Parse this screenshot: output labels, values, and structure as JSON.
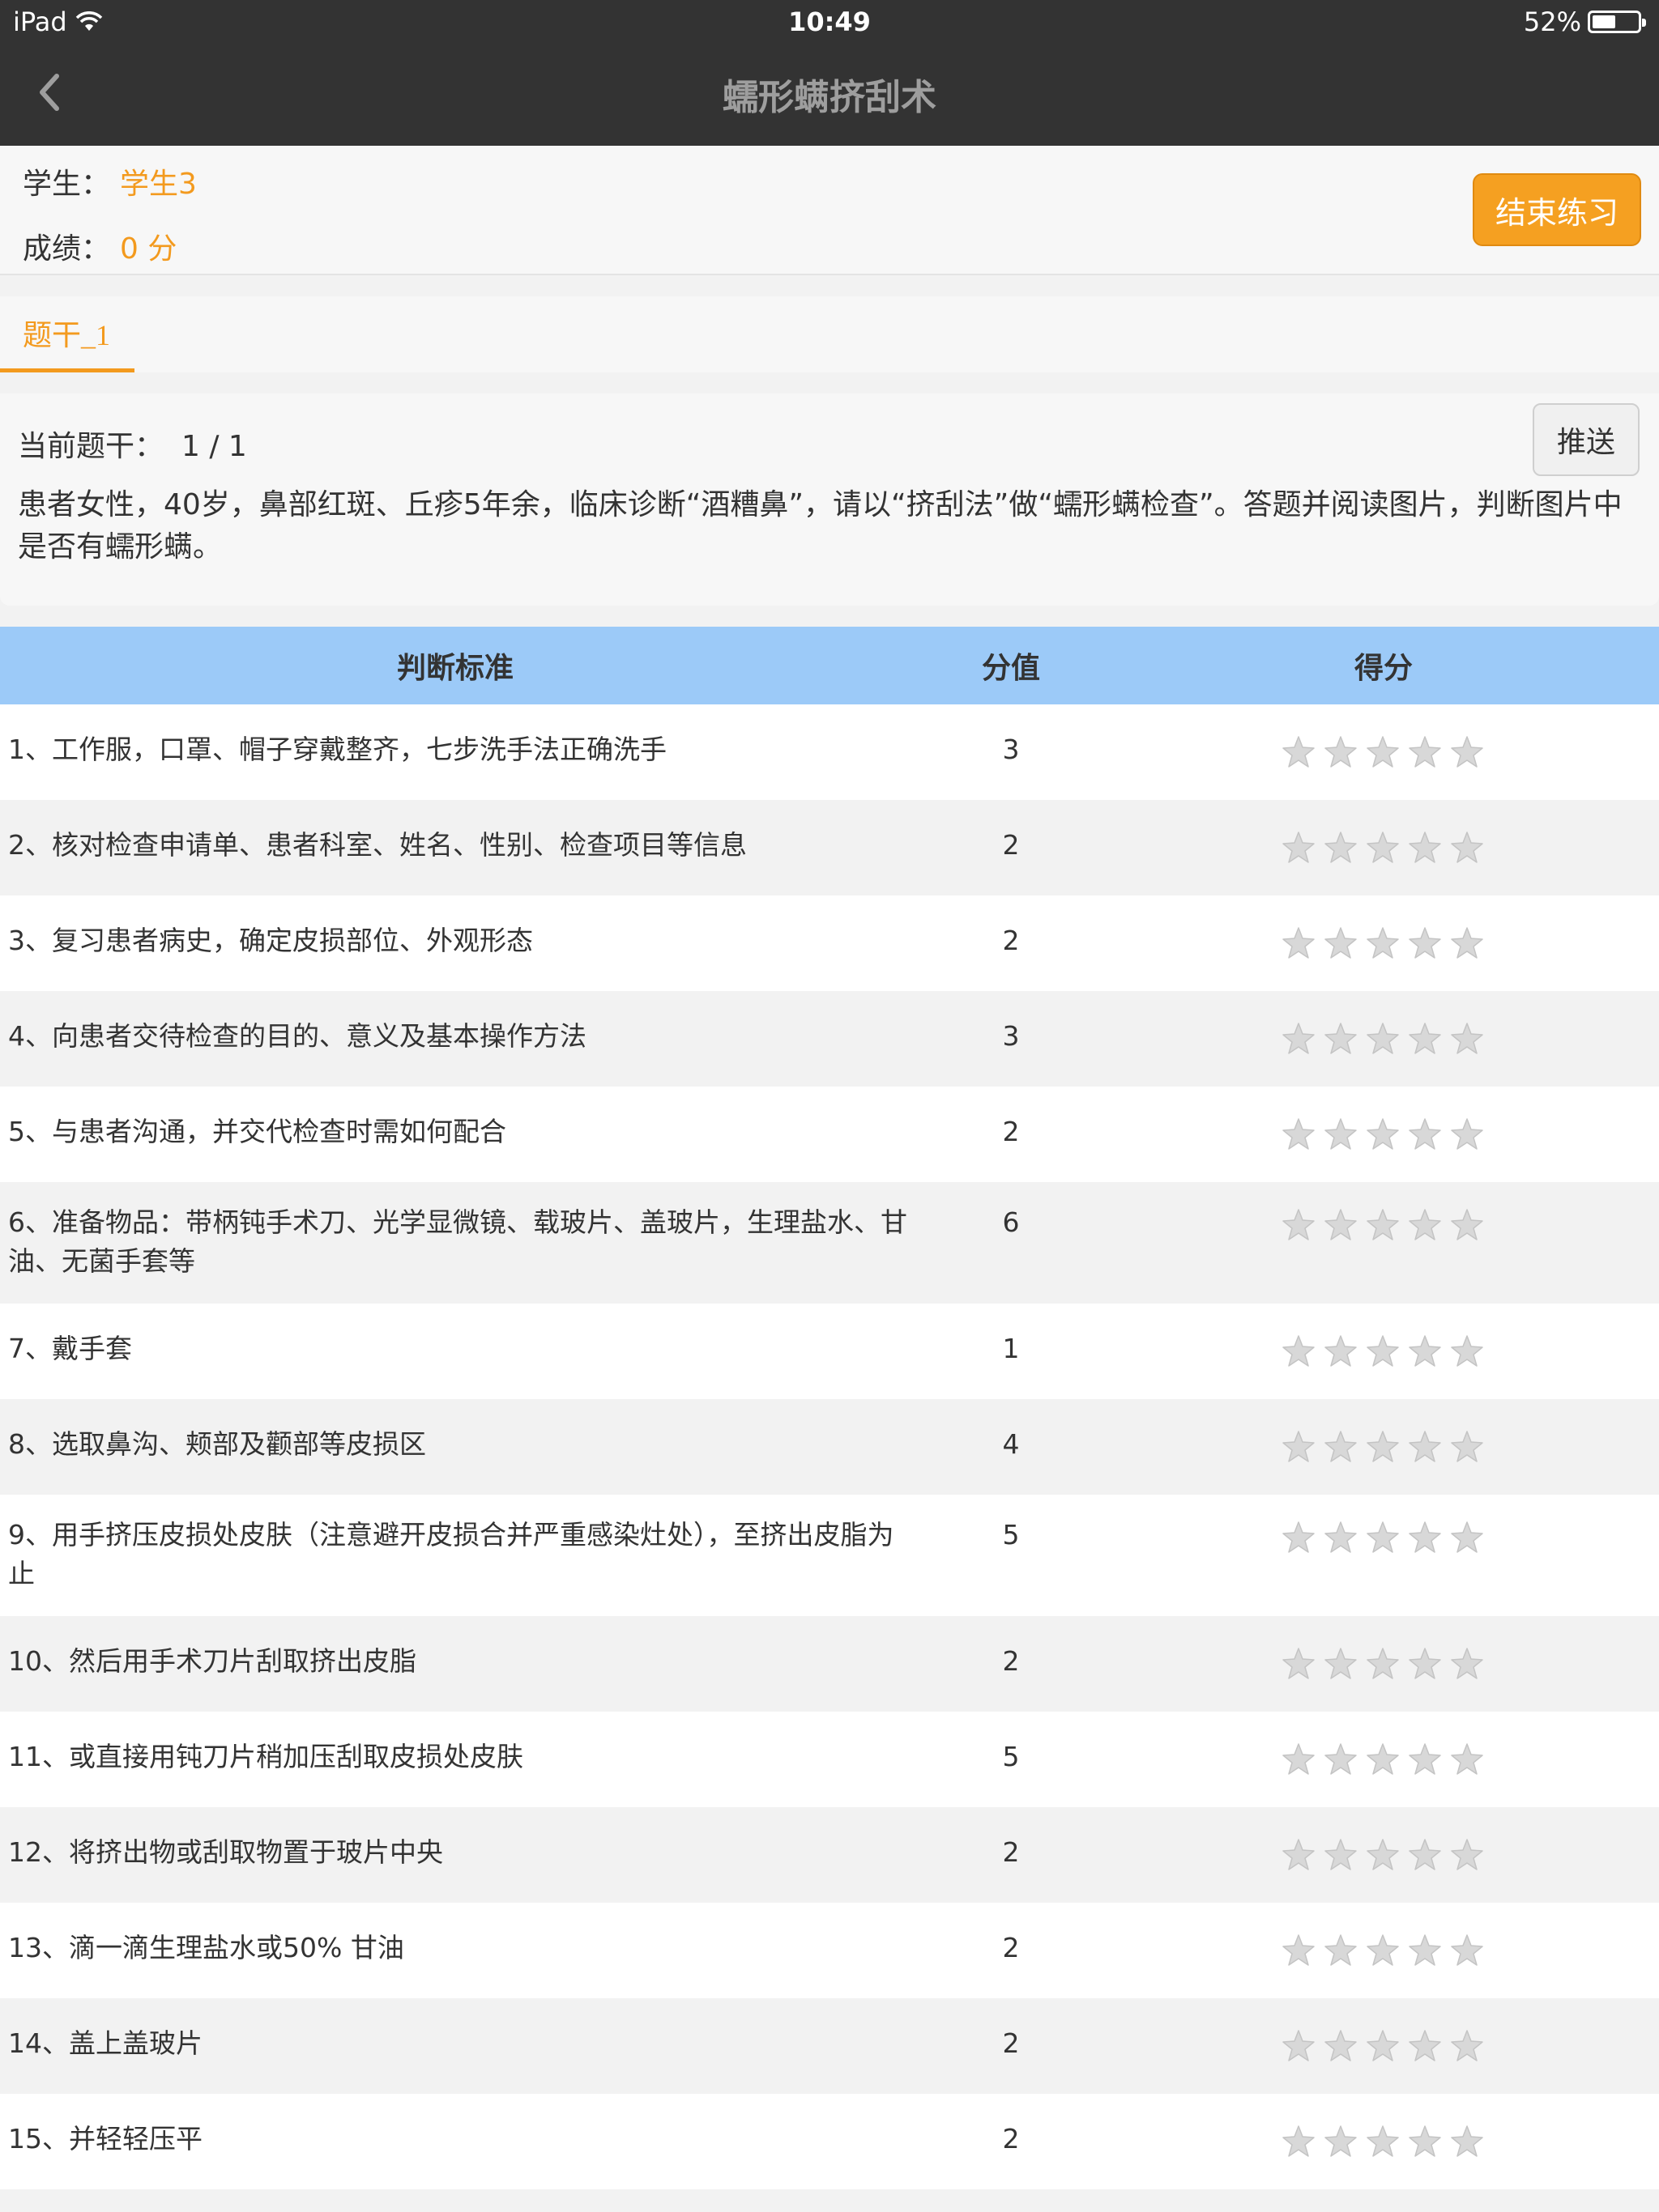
{
  "status": {
    "carrier": "iPad",
    "time": "10:49",
    "battery": "52%",
    "battery_level": 0.52
  },
  "nav": {
    "title": "蠕形螨挤刮术"
  },
  "info": {
    "student_label": "学生：",
    "student_value": "学生3",
    "score_label": "成绩：",
    "score_value": "0 分",
    "end_button": "结束练习"
  },
  "tabs": [
    {
      "label": "题干_1",
      "active": true
    }
  ],
  "question": {
    "current_label": "当前题干：",
    "current_value": "1 / 1",
    "push_button": "推送",
    "text": "患者女性，40岁，鼻部红斑、丘疹5年余，临床诊断“酒糟鼻”，请以“挤刮法”做“蠕形螨检查”。答题并阅读图片，判断图片中是否有蠕形螨。"
  },
  "table": {
    "headers": {
      "criterion": "判断标准",
      "score": "分值",
      "earned": "得分"
    },
    "max_stars": 5,
    "rows": [
      {
        "criterion": "1、工作服，口罩、帽子穿戴整齐，七步洗手法正确洗手",
        "score": "3",
        "stars": 0
      },
      {
        "criterion": "2、核对检查申请单、患者科室、姓名、性别、检查项目等信息",
        "score": "2",
        "stars": 0
      },
      {
        "criterion": "3、复习患者病史，确定皮损部位、外观形态",
        "score": "2",
        "stars": 0
      },
      {
        "criterion": "4、向患者交待检查的目的、意义及基本操作方法",
        "score": "3",
        "stars": 0
      },
      {
        "criterion": "5、与患者沟通，并交代检查时需如何配合",
        "score": "2",
        "stars": 0
      },
      {
        "criterion": "6、准备物品：带柄钝手术刀、光学显微镜、载玻片、盖玻片，生理盐水、甘油、无菌手套等",
        "score": "6",
        "stars": 0
      },
      {
        "criterion": "7、戴手套",
        "score": "1",
        "stars": 0
      },
      {
        "criterion": "8、选取鼻沟、颊部及颧部等皮损区",
        "score": "4",
        "stars": 0
      },
      {
        "criterion": "9、用手挤压皮损处皮肤（注意避开皮损合并严重感染灶处），至挤出皮脂为止",
        "score": "5",
        "stars": 0
      },
      {
        "criterion": "10、然后用手术刀片刮取挤出皮脂",
        "score": "2",
        "stars": 0
      },
      {
        "criterion": "11、或直接用钝刀片稍加压刮取皮损处皮肤",
        "score": "5",
        "stars": 0
      },
      {
        "criterion": "12、将挤出物或刮取物置于玻片中央",
        "score": "2",
        "stars": 0
      },
      {
        "criterion": "13、滴一滴生理盐水或50% 甘油",
        "score": "2",
        "stars": 0
      },
      {
        "criterion": "14、盖上盖玻片",
        "score": "2",
        "stars": 0
      },
      {
        "criterion": "15、并轻轻压平",
        "score": "2",
        "stars": 0
      }
    ]
  },
  "colors": {
    "accent": "#f39a1e",
    "header_bg": "#333333",
    "table_header": "#9ccaf8",
    "star_empty": "#d8d8d8"
  }
}
